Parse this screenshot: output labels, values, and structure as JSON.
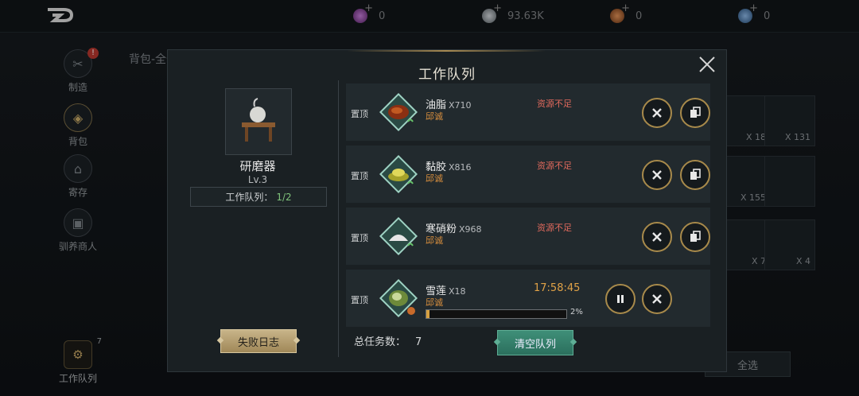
{
  "topbar": {
    "resources": [
      {
        "icon": "purple-gem-icon",
        "value": "0",
        "color": "#8c3fa5"
      },
      {
        "icon": "silver-coin-icon",
        "value": "93.63K",
        "color": "#9aa2a8"
      },
      {
        "icon": "copper-coin-icon",
        "value": "0",
        "color": "#b06a3a"
      },
      {
        "icon": "blue-gem-icon",
        "value": "0",
        "color": "#4f7fb3"
      }
    ]
  },
  "sidebar": {
    "items": [
      {
        "label": "制造",
        "badge": "!"
      },
      {
        "label": "背包"
      },
      {
        "label": "寄存"
      },
      {
        "label": "驯养商人"
      }
    ],
    "queue": {
      "label": "工作队列",
      "count": "7"
    }
  },
  "background": {
    "title": "背包-全部",
    "tiles": [
      {
        "qty": "X 18"
      },
      {
        "qty": "X 131"
      },
      {
        "qty": "X 155"
      },
      {
        "qty": "X 7"
      },
      {
        "qty": "X 4"
      }
    ],
    "select_all": "全选"
  },
  "dialog": {
    "title": "工作队列",
    "device": {
      "name": "研磨器",
      "level": "Lv.3"
    },
    "queue_label": "工作队列：",
    "queue_value": "1/2",
    "fail_log": "失败日志",
    "pin_label": "置顶",
    "items": [
      {
        "name": "油脂",
        "qty": "X710",
        "owner": "邱诚",
        "status": "资源不足",
        "icon": "grease-icon"
      },
      {
        "name": "黏胶",
        "qty": "X816",
        "owner": "邱诚",
        "status": "资源不足",
        "icon": "glue-icon"
      },
      {
        "name": "寒硝粉",
        "qty": "X968",
        "owner": "邱诚",
        "status": "资源不足",
        "icon": "saltpeter-powder-icon"
      },
      {
        "name": "雪莲",
        "qty": "X18",
        "owner": "邱诚",
        "timer": "17:58:45",
        "progress_pct": 2,
        "progress_label": "2%",
        "icon": "snow-lotus-icon"
      }
    ],
    "total_label": "总任务数：",
    "total_value": "7",
    "clear_btn": "清空队列"
  },
  "colors": {
    "accent_gold": "#a88a4b",
    "warning_red": "#e26a5d",
    "owner_orange": "#d98f3e",
    "timer": "#e0a247",
    "clear_green": "#2b6f5d"
  }
}
